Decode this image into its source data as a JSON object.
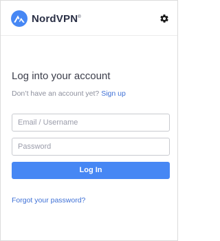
{
  "header": {
    "brand_name": "NordVPN",
    "brand_mark": "®",
    "logo_icon": "nordvpn-mountain-logo-icon",
    "settings_icon": "gear-icon"
  },
  "login": {
    "title": "Log into your account",
    "no_account_text": "Don’t have an account yet?",
    "signup_link": "Sign up",
    "email_placeholder": "Email / Username",
    "password_placeholder": "Password",
    "login_button": "Log In",
    "forgot_link": "Forgot your password?"
  },
  "colors": {
    "accent": "#4687f4",
    "link": "#3e70d6",
    "text": "#3b3d4a",
    "muted": "#8c8f9c"
  }
}
